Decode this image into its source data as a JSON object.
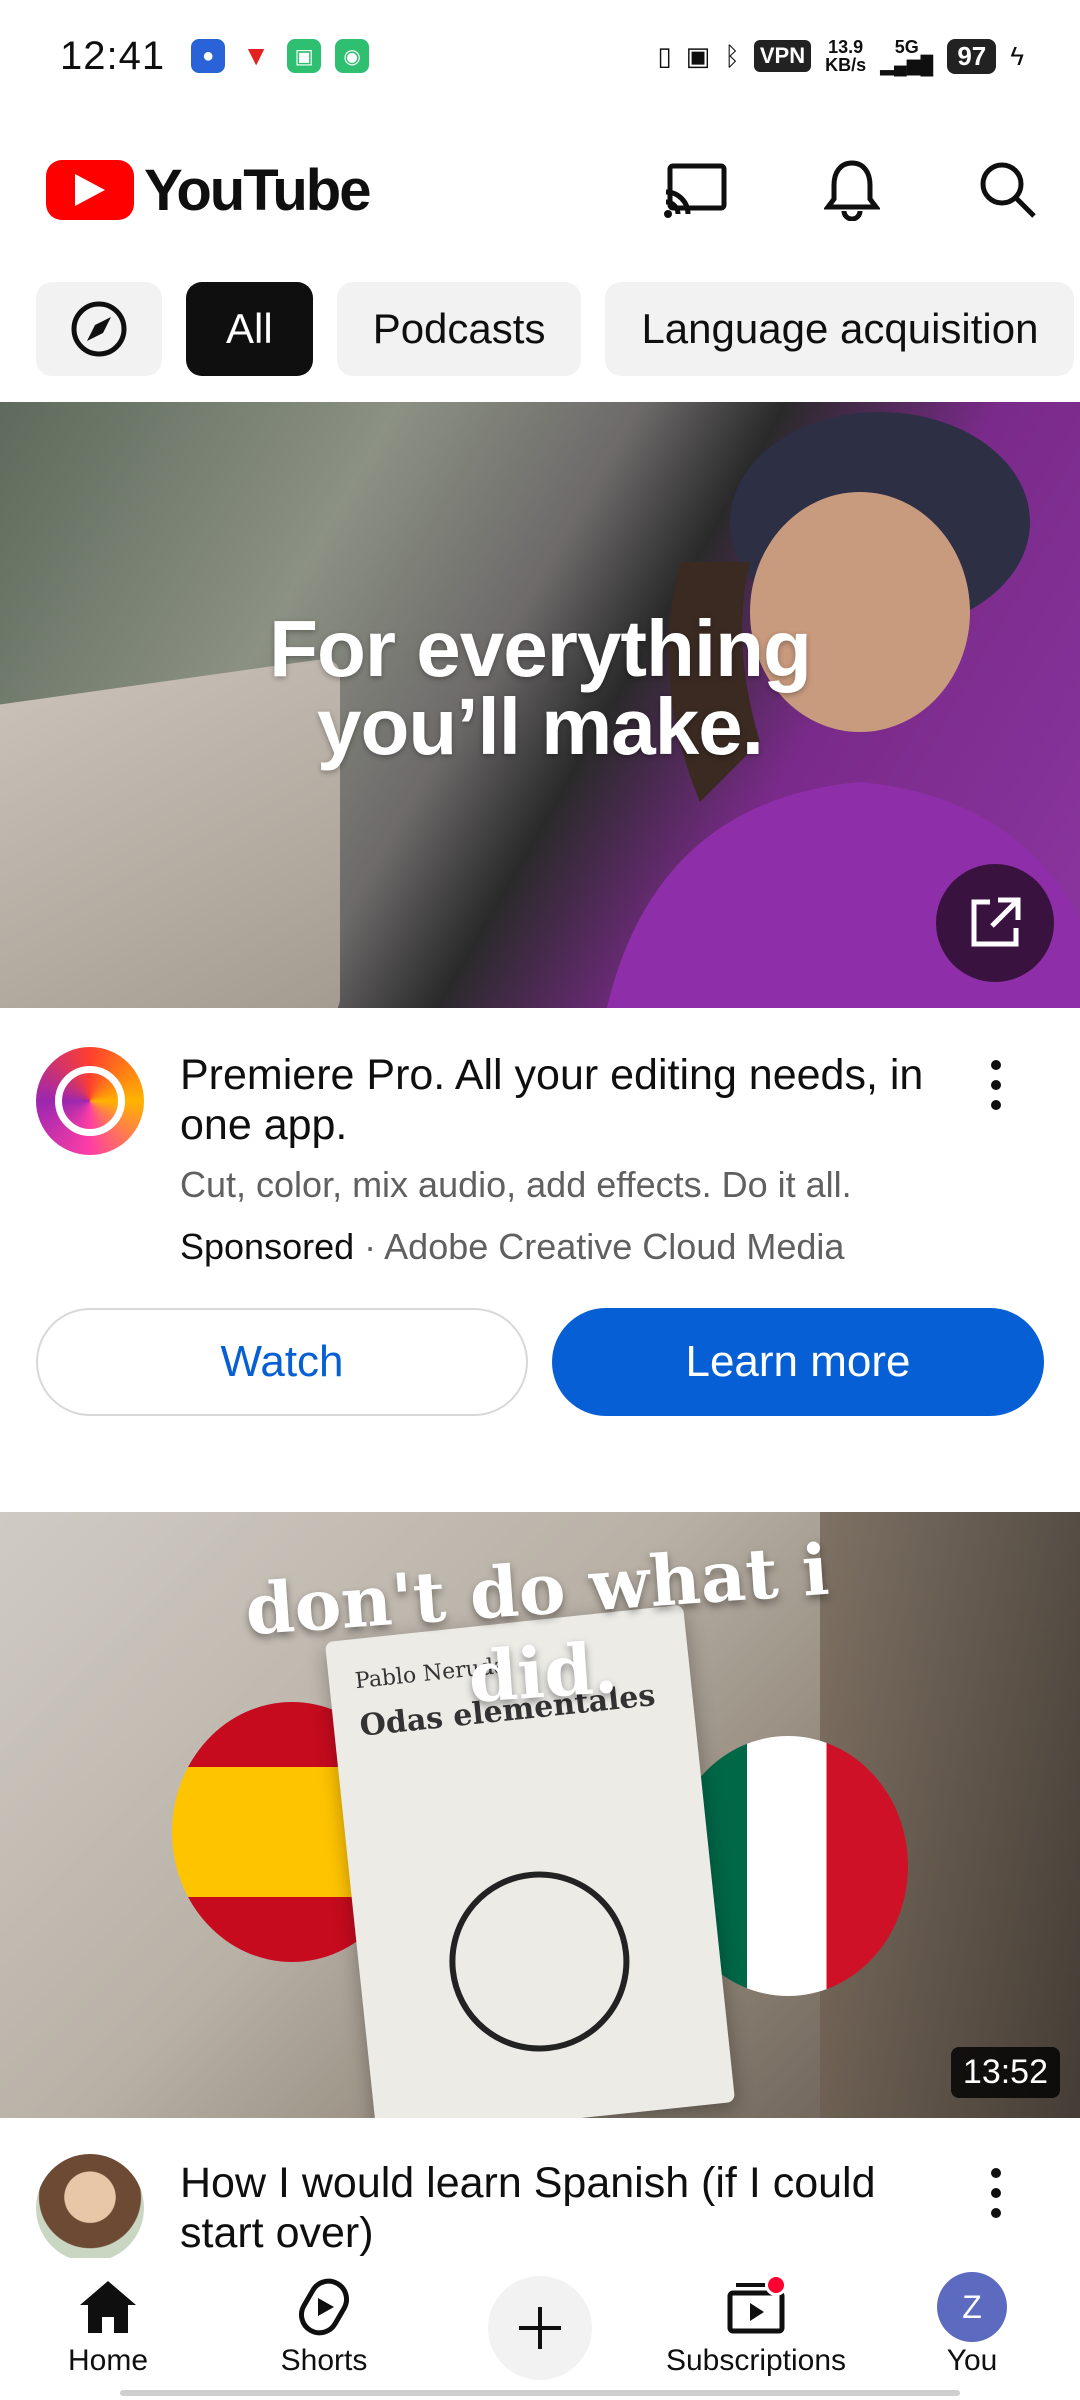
{
  "status_bar": {
    "time": "12:41",
    "network_speed_value": "13.9",
    "network_speed_unit": "KB/s",
    "network_type": "5G",
    "vpn_label": "VPN",
    "battery": "97"
  },
  "header": {
    "logo_text": "YouTube",
    "actions": [
      "cast-icon",
      "notifications-icon",
      "search-icon"
    ]
  },
  "chips": [
    {
      "label": "",
      "icon": "compass-icon"
    },
    {
      "label": "All",
      "active": true
    },
    {
      "label": "Podcasts"
    },
    {
      "label": "Language acquisition"
    }
  ],
  "ad": {
    "headline_line1": "For everything",
    "headline_line2": "you’ll make.",
    "title": "Premiere Pro. All your editing needs, in one app.",
    "description": "Cut, color, mix audio, add effects. Do it all.",
    "sponsored_label": "Sponsored",
    "separator": " · ",
    "advertiser": "Adobe Creative Cloud Media",
    "watch_label": "Watch",
    "learn_more_label": "Learn more",
    "accent_color": "#065fd4"
  },
  "video": {
    "thumbnail_text": "don't do what i did.",
    "book_author": "Pablo Neruda",
    "book_title": "Odas elementales",
    "duration": "13:52",
    "title": "How I would learn Spanish (if I could start over)"
  },
  "bottom_nav": {
    "home": "Home",
    "shorts": "Shorts",
    "subscriptions": "Subscriptions",
    "you": "You",
    "you_avatar_letter": "Z"
  },
  "colors": {
    "brand_red": "#ff0000",
    "chip_active_bg": "#0f0f0f",
    "chip_bg": "#f2f2f2",
    "notification_dot": "#ff0033"
  }
}
